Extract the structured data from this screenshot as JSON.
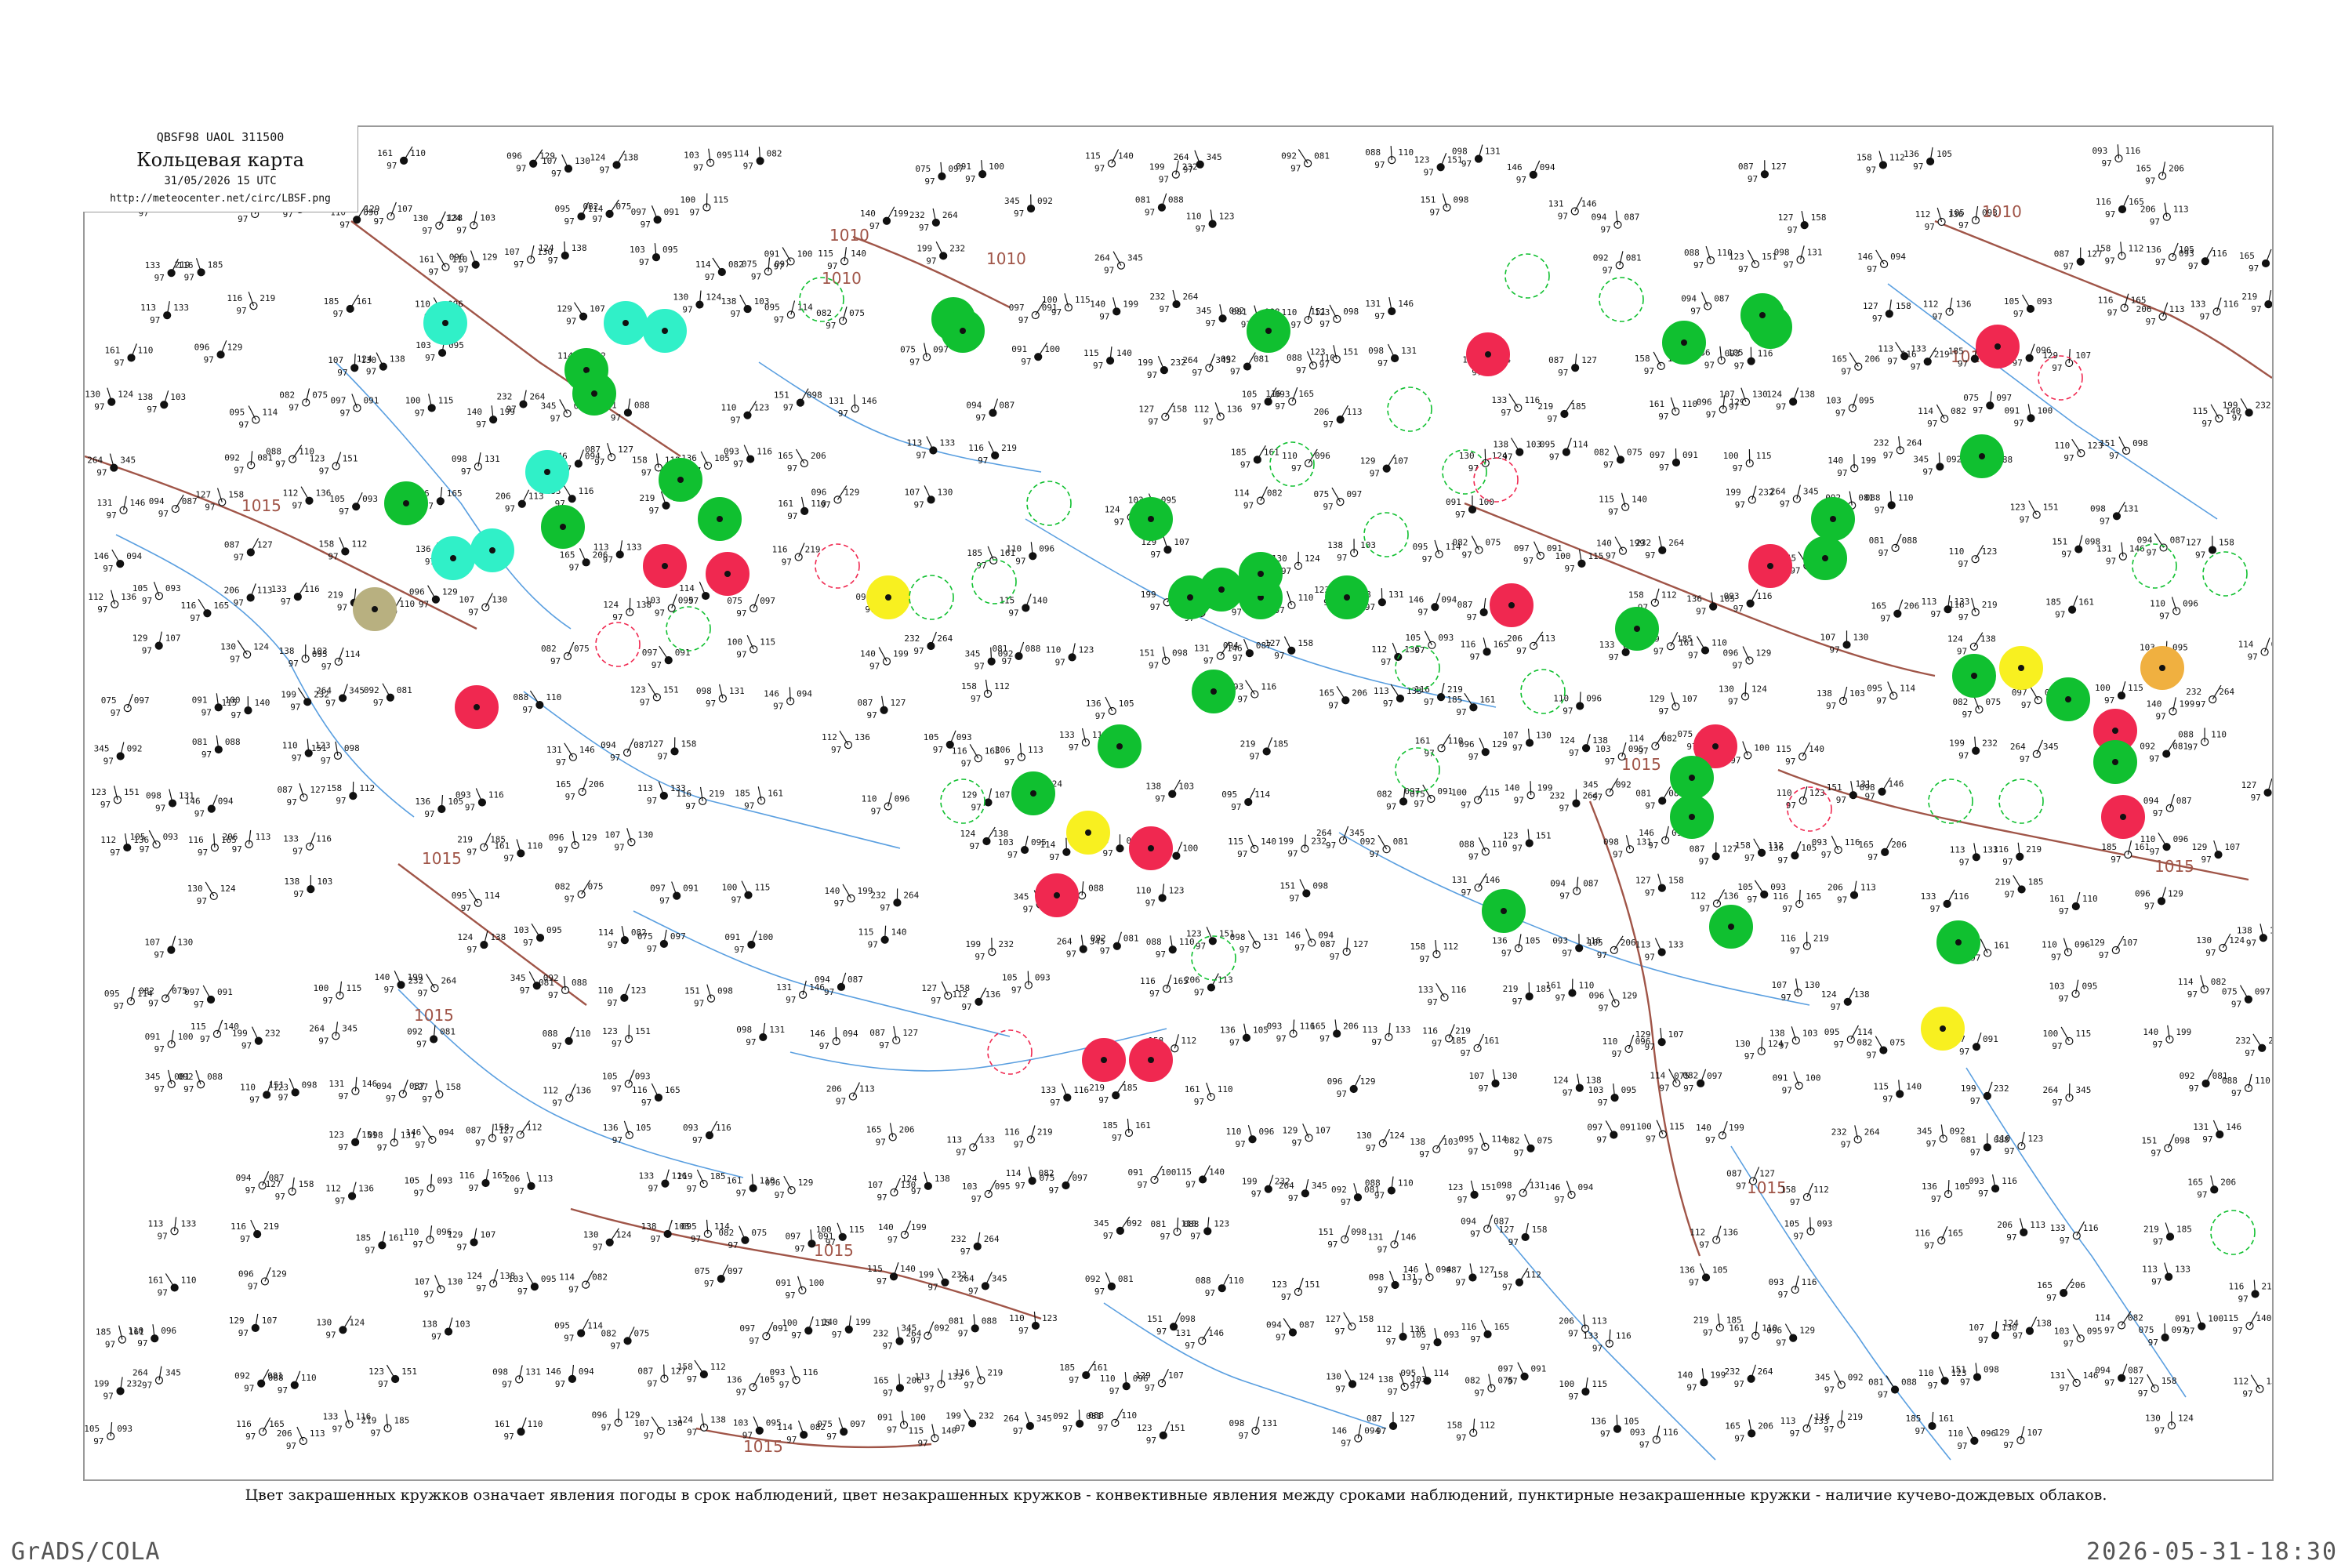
{
  "header": {
    "code": "QBSF98  UAOL  311500",
    "title": "Кольцевая карта",
    "date": "31/05/2026 15 UTC",
    "url": "http://meteocenter.net/circ/LBSF.png"
  },
  "caption": "Цвет закрашенных кружков означает явления погоды в срок наблюдений, цвет незакрашенных кружков - конвективные явления между сроками наблюдений, пунктирные незакрашенные кружки - наличие кучево-дождевых облаков.",
  "footer": {
    "left": "GrADS/COLA",
    "right": "2026-05-31-18:30"
  },
  "colors": {
    "isobar": "#a05548",
    "river": "#5a9fe0",
    "border": "#9a9a9a",
    "rain_green": "#10c030",
    "thunder_red": "#f02850",
    "fog_yellow": "#f8f020",
    "shower_cyan": "#30f0c8",
    "haze_olive": "#b8b080",
    "orange": "#f0b040"
  },
  "isobar_labels": [
    "1010",
    "1010",
    "1010",
    "1010",
    "1015",
    "1015",
    "1015",
    "1015",
    "1015",
    "1015",
    "1015",
    "1015",
    "1015"
  ],
  "station_values": [
    "116",
    "165",
    "206",
    "113",
    "133",
    "116",
    "219",
    "185",
    "161",
    "110",
    "096",
    "129",
    "107",
    "130",
    "124",
    "138",
    "103",
    "095",
    "114",
    "082",
    "075",
    "097",
    "091",
    "100",
    "115",
    "140",
    "199",
    "232",
    "264",
    "345",
    "092",
    "081",
    "088",
    "110",
    "123",
    "151",
    "098",
    "131",
    "146",
    "094",
    "087",
    "127",
    "158",
    "112",
    "136",
    "105",
    "093"
  ]
}
